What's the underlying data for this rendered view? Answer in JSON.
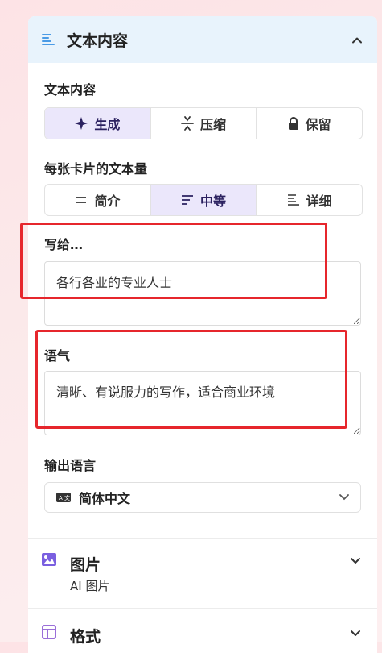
{
  "text_section": {
    "title": "文本内容",
    "content_label": "文本内容",
    "content_options": [
      {
        "label": "生成",
        "icon": "sparkle-icon",
        "active": true
      },
      {
        "label": "压缩",
        "icon": "compress-icon",
        "active": false
      },
      {
        "label": "保留",
        "icon": "lock-icon",
        "active": false
      }
    ],
    "amount_label": "每张卡片的文本量",
    "amount_options": [
      {
        "label": "简介",
        "icon": "brief-lines-icon",
        "active": false
      },
      {
        "label": "中等",
        "icon": "medium-lines-icon",
        "active": true
      },
      {
        "label": "详细",
        "icon": "detailed-lines-icon",
        "active": false
      }
    ],
    "audience_label": "写给…",
    "audience_value": "各行各业的专业人士",
    "tone_label": "语气",
    "tone_value": "清晰、有说服力的写作，适合商业环境",
    "language_label": "输出语言",
    "language_value": "简体中文"
  },
  "image_section": {
    "title": "图片",
    "subtitle": "AI 图片"
  },
  "format_section": {
    "title": "格式"
  },
  "colors": {
    "accent": "#6a5bd6",
    "highlight": "#e6262c",
    "header_bg": "#e8f3fc",
    "active_bg": "#ebe7fb"
  }
}
